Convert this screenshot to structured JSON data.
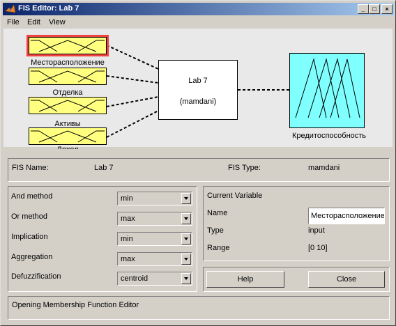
{
  "window": {
    "title": "FIS Editor: Lab 7",
    "controls": {
      "minimize": "_",
      "maximize": "□",
      "close": "×"
    }
  },
  "menu": [
    "File",
    "Edit",
    "View"
  ],
  "diagram": {
    "inputs": [
      "Месторасположение",
      "Отделка",
      "Активы",
      "Доход"
    ],
    "selected_input": "Месторасположение",
    "system_name": "Lab 7",
    "system_type": "(mamdani)",
    "output": "Кредитоспособность",
    "colors": {
      "input_fill": "#ffff80",
      "output_fill": "#80ffff",
      "selection": "#f04040"
    }
  },
  "fis_info": {
    "name_label": "FIS Name:",
    "name_value": "Lab 7",
    "type_label": "FIS Type:",
    "type_value": "mamdani"
  },
  "methods": [
    {
      "label": "And method",
      "value": "min"
    },
    {
      "label": "Or method",
      "value": "max"
    },
    {
      "label": "Implication",
      "value": "min"
    },
    {
      "label": "Aggregation",
      "value": "max"
    },
    {
      "label": "Defuzzification",
      "value": "centroid"
    }
  ],
  "current_variable": {
    "heading": "Current Variable",
    "name_label": "Name",
    "name_value": "Месторасположение",
    "type_label": "Type",
    "type_value": "input",
    "range_label": "Range",
    "range_value": "[0 10]"
  },
  "buttons": {
    "help": "Help",
    "close": "Close"
  },
  "status": "Opening Membership Function Editor"
}
